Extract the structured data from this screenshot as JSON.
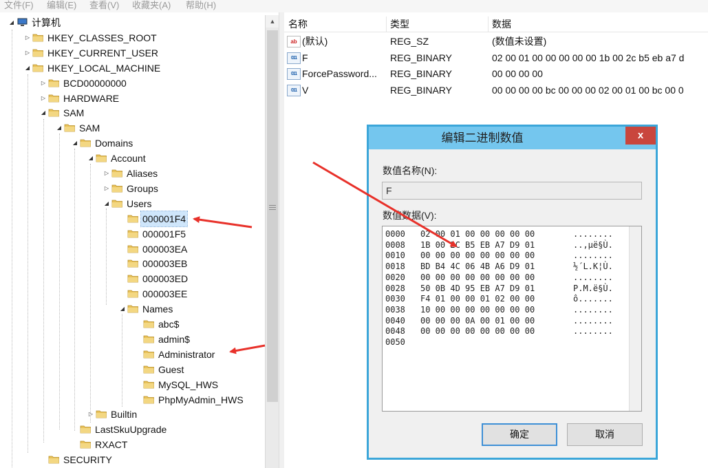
{
  "menu": [
    "文件(F)",
    "编辑(E)",
    "查看(V)",
    "收藏夹(A)",
    "帮助(H)"
  ],
  "tree": {
    "nodes": [
      {
        "label": "计算机",
        "depth": 0,
        "exp": "◢",
        "root": true
      },
      {
        "label": "HKEY_CLASSES_ROOT",
        "depth": 1,
        "exp": "▷"
      },
      {
        "label": "HKEY_CURRENT_USER",
        "depth": 1,
        "exp": "▷"
      },
      {
        "label": "HKEY_LOCAL_MACHINE",
        "depth": 1,
        "exp": "◢"
      },
      {
        "label": "BCD00000000",
        "depth": 2,
        "exp": "▷"
      },
      {
        "label": "HARDWARE",
        "depth": 2,
        "exp": "▷"
      },
      {
        "label": "SAM",
        "depth": 2,
        "exp": "◢"
      },
      {
        "label": "SAM",
        "depth": 3,
        "exp": "◢"
      },
      {
        "label": "Domains",
        "depth": 4,
        "exp": "◢"
      },
      {
        "label": "Account",
        "depth": 5,
        "exp": "◢"
      },
      {
        "label": "Aliases",
        "depth": 6,
        "exp": "▷"
      },
      {
        "label": "Groups",
        "depth": 6,
        "exp": "▷"
      },
      {
        "label": "Users",
        "depth": 6,
        "exp": "◢"
      },
      {
        "label": "000001F4",
        "depth": 7,
        "exp": "",
        "selected": true
      },
      {
        "label": "000001F5",
        "depth": 7,
        "exp": ""
      },
      {
        "label": "000003EA",
        "depth": 7,
        "exp": ""
      },
      {
        "label": "000003EB",
        "depth": 7,
        "exp": ""
      },
      {
        "label": "000003ED",
        "depth": 7,
        "exp": ""
      },
      {
        "label": "000003EE",
        "depth": 7,
        "exp": ""
      },
      {
        "label": "Names",
        "depth": 7,
        "exp": "◢"
      },
      {
        "label": "abc$",
        "depth": 8,
        "exp": ""
      },
      {
        "label": "admin$",
        "depth": 8,
        "exp": ""
      },
      {
        "label": "Administrator",
        "depth": 8,
        "exp": ""
      },
      {
        "label": "Guest",
        "depth": 8,
        "exp": ""
      },
      {
        "label": "MySQL_HWS",
        "depth": 8,
        "exp": ""
      },
      {
        "label": "PhpMyAdmin_HWS",
        "depth": 8,
        "exp": ""
      },
      {
        "label": "Builtin",
        "depth": 5,
        "exp": "▷"
      },
      {
        "label": "LastSkuUpgrade",
        "depth": 4,
        "exp": ""
      },
      {
        "label": "RXACT",
        "depth": 4,
        "exp": ""
      },
      {
        "label": "SECURITY",
        "depth": 2,
        "exp": ""
      }
    ]
  },
  "list": {
    "columns": [
      "名称",
      "类型",
      "数据"
    ],
    "rows": [
      {
        "icon": "string-value-icon",
        "name": "(默认)",
        "type": "REG_SZ",
        "data": "(数值未设置)"
      },
      {
        "icon": "binary-value-icon",
        "name": "F",
        "type": "REG_BINARY",
        "data": "02 00 01 00 00 00 00 00 1b 00 2c b5 eb a7 d"
      },
      {
        "icon": "binary-value-icon",
        "name": "ForcePassword...",
        "type": "REG_BINARY",
        "data": "00 00 00 00"
      },
      {
        "icon": "binary-value-icon",
        "name": "V",
        "type": "REG_BINARY",
        "data": "00 00 00 00 bc 00 00 00 02 00 01 00 bc 00 0"
      }
    ]
  },
  "dialog": {
    "title": "编辑二进制数值",
    "close_glyph": "x",
    "name_label": "数值名称(N):",
    "name_value": "F",
    "data_label": "数值数据(V):",
    "hex_rows": [
      {
        "off": "0000",
        "bytes": "02 00 01 00 00 00 00 00",
        "ascii": "........"
      },
      {
        "off": "0008",
        "bytes": "1B 00 2C B5 EB A7 D9 01",
        "ascii": "..,µë§Ù."
      },
      {
        "off": "0010",
        "bytes": "00 00 00 00 00 00 00 00",
        "ascii": "........"
      },
      {
        "off": "0018",
        "bytes": "BD B4 4C 06 4B A6 D9 01",
        "ascii": "½´L.K¦Ù."
      },
      {
        "off": "0020",
        "bytes": "00 00 00 00 00 00 00 00",
        "ascii": "........"
      },
      {
        "off": "0028",
        "bytes": "50 0B 4D 95 EB A7 D9 01",
        "ascii": "P.M.ë§Ù."
      },
      {
        "off": "0030",
        "bytes": "F4 01 00 00 01 02 00 00",
        "ascii": "ô......."
      },
      {
        "off": "0038",
        "bytes": "10 00 00 00 00 00 00 00",
        "ascii": "........"
      },
      {
        "off": "0040",
        "bytes": "00 00 00 0A 00 01 00 00",
        "ascii": "........"
      },
      {
        "off": "0048",
        "bytes": "00 00 00 00 00 00 00 00",
        "ascii": "........"
      },
      {
        "off": "0050",
        "bytes": "",
        "ascii": ""
      }
    ],
    "ok_label": "确定",
    "cancel_label": "取消"
  },
  "colors": {
    "annotation_arrow": "#e8312a",
    "dialog_border": "#3ba6d9",
    "dialog_titlebar": "#74c6ee",
    "close_button": "#c9463d",
    "folder": "#e9c25a"
  }
}
